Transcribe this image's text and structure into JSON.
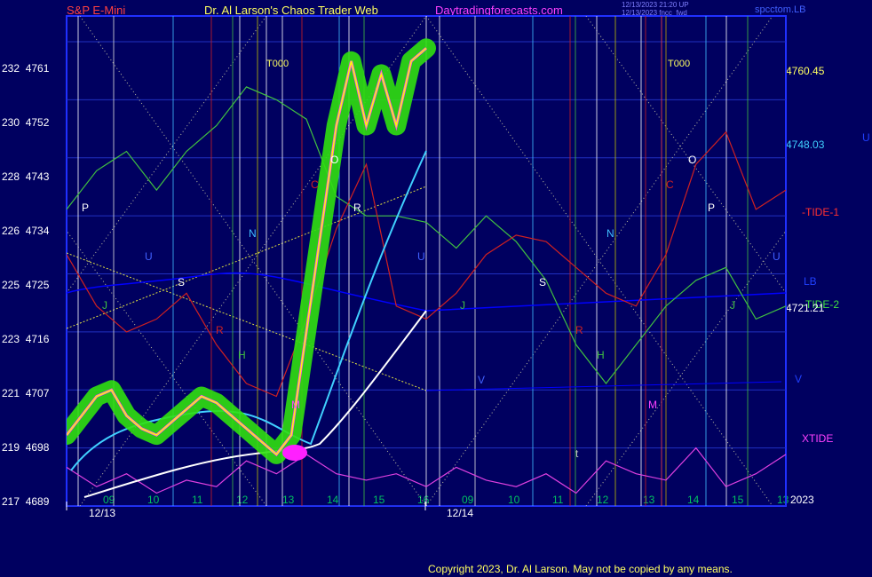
{
  "header": {
    "symbol": "S&P E-Mini",
    "author": "Dr. Al Larson's Chaos Trader Web",
    "site": "Daytradingforecasts.com",
    "stamp1": "12/13/2023 21:20 UP",
    "stamp2": "12/13/2023 fncc_fwd",
    "corner": "spcctom.LB"
  },
  "copyright": "Copyright 2023, Dr. Al Larson. May not be copied by any means.",
  "colors": {
    "background": "#000060",
    "grid": "#2030c0",
    "price": "#ffff00",
    "tide1": "#d02020",
    "tide2": "#40c040",
    "xtide": "#e040e0",
    "lb": "#0000ff",
    "cyan": "#40d0ff",
    "white": "#ffffff",
    "glow": "#30e010"
  },
  "chart_data": {
    "type": "line",
    "title": "S&P E-Mini",
    "ylim": [
      4689,
      4765
    ],
    "y_ticks_left": [
      {
        "num": "232",
        "price": "4761"
      },
      {
        "num": "230",
        "price": "4752"
      },
      {
        "num": "228",
        "price": "4743"
      },
      {
        "num": "226",
        "price": "4734"
      },
      {
        "num": "225",
        "price": "4725"
      },
      {
        "num": "223",
        "price": "4716"
      },
      {
        "num": "221",
        "price": "4707"
      },
      {
        "num": "219",
        "price": "4698"
      },
      {
        "num": "217",
        "price": "4689"
      }
    ],
    "x_ticks": [
      "09",
      "10",
      "11",
      "12",
      "13",
      "14",
      "15",
      "16",
      "09",
      "10",
      "11",
      "12",
      "13",
      "14",
      "15",
      "13"
    ],
    "dates": [
      "12/13",
      "12/14"
    ],
    "year": "2023",
    "right_labels": [
      {
        "text": "4760.45",
        "color": "#ffff60"
      },
      {
        "text": "4748.03",
        "color": "#40d0ff"
      },
      {
        "text": "-TIDE-1",
        "color": "#ff3030"
      },
      {
        "text": "LB",
        "color": "#2040ff"
      },
      {
        "text": "-TIDE-2",
        "color": "#40e040"
      },
      {
        "text": "4721.21",
        "color": "#ffffff"
      },
      {
        "text": "V",
        "color": "#2040ff"
      },
      {
        "text": "XTIDE",
        "color": "#ff40ff"
      },
      {
        "text": "U",
        "color": "#2040ff"
      }
    ],
    "markers": [
      "T000",
      "T000"
    ],
    "phase_letters": [
      "P",
      "U",
      "J",
      "S",
      "R",
      "H",
      "N",
      "M",
      "O",
      "C",
      "R",
      "U",
      "J",
      "S",
      "R",
      "H",
      "N",
      "M",
      "O",
      "C",
      "P",
      "U",
      "J",
      "V",
      "t"
    ],
    "series": [
      {
        "name": "Price",
        "values": [
          4700,
          4703,
          4706,
          4707,
          4703,
          4701,
          4700,
          4702,
          4704,
          4706,
          4705,
          4703,
          4701,
          4699,
          4697,
          4700,
          4716,
          4732,
          4748,
          4758,
          4748,
          4756,
          4748,
          4758,
          4760
        ]
      },
      {
        "name": "TIDE-1",
        "values": [
          4728,
          4720,
          4716,
          4718,
          4722,
          4714,
          4708,
          4706,
          4718,
          4732,
          4742,
          4720,
          4718,
          4722,
          4728,
          4731,
          4730,
          4726,
          4722,
          4720,
          4728,
          4742,
          4747,
          4735,
          4738
        ]
      },
      {
        "name": "TIDE-2",
        "values": [
          4735,
          4741,
          4744,
          4738,
          4744,
          4748,
          4754,
          4752,
          4749,
          4737,
          4734,
          4734,
          4733,
          4729,
          4734,
          4730,
          4724,
          4714,
          4708,
          4714,
          4720,
          4724,
          4726,
          4718,
          4720
        ]
      },
      {
        "name": "XTIDE",
        "values": [
          4695,
          4692,
          4694,
          4691,
          4693,
          4692,
          4696,
          4694,
          4697,
          4694,
          4693,
          4694,
          4692,
          4695,
          4693,
          4692,
          4694,
          4691,
          4696,
          4694,
          4693,
          4698,
          4692,
          4694,
          4697
        ]
      }
    ]
  }
}
